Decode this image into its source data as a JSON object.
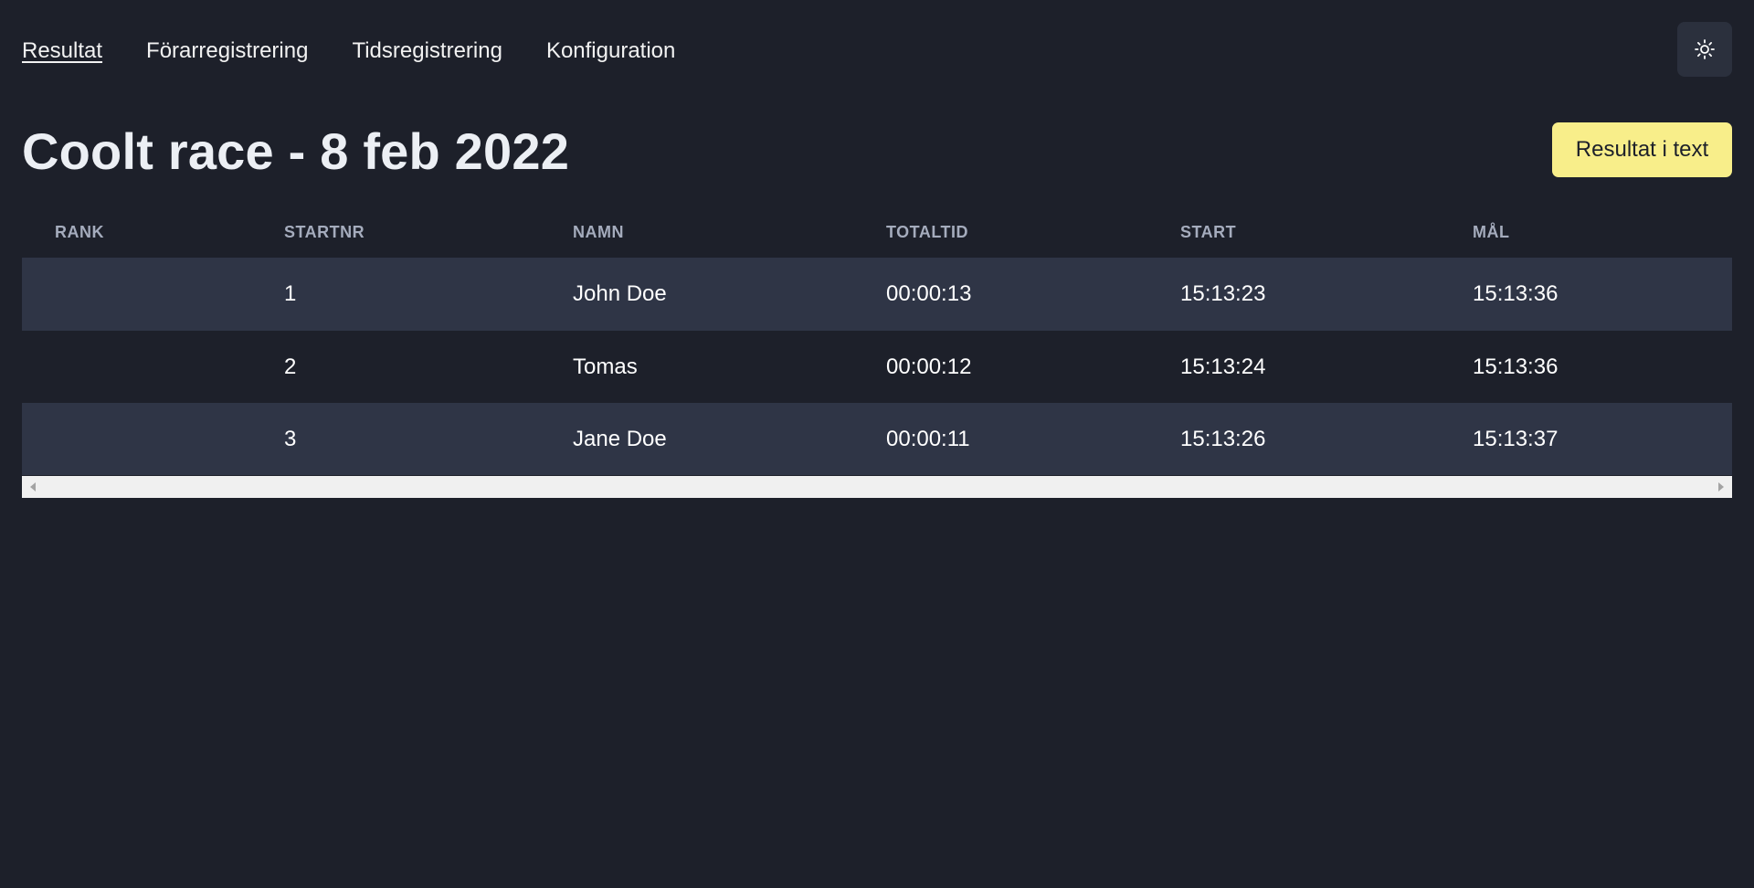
{
  "nav": {
    "items": [
      {
        "label": "Resultat",
        "active": true
      },
      {
        "label": "Förarregistrering",
        "active": false
      },
      {
        "label": "Tidsregistrering",
        "active": false
      },
      {
        "label": "Konfiguration",
        "active": false
      }
    ],
    "theme_icon": "sun-icon"
  },
  "header": {
    "title": "Coolt race - 8 feb 2022",
    "text_button_label": "Resultat i text"
  },
  "table": {
    "columns": [
      "RANK",
      "STARTNR",
      "NAMN",
      "TOTALTID",
      "START",
      "MÅL"
    ],
    "rows": [
      {
        "rank": "",
        "startnr": "1",
        "namn": "John Doe",
        "totaltid": "00:00:13",
        "start": "15:13:23",
        "mal": "15:13:36"
      },
      {
        "rank": "",
        "startnr": "2",
        "namn": "Tomas",
        "totaltid": "00:00:12",
        "start": "15:13:24",
        "mal": "15:13:36"
      },
      {
        "rank": "",
        "startnr": "3",
        "namn": "Jane Doe",
        "totaltid": "00:00:11",
        "start": "15:13:26",
        "mal": "15:13:37"
      }
    ]
  },
  "colors": {
    "background": "#1d202a",
    "row_alt": "#2f3546",
    "accent_button": "#f8ee8a"
  }
}
